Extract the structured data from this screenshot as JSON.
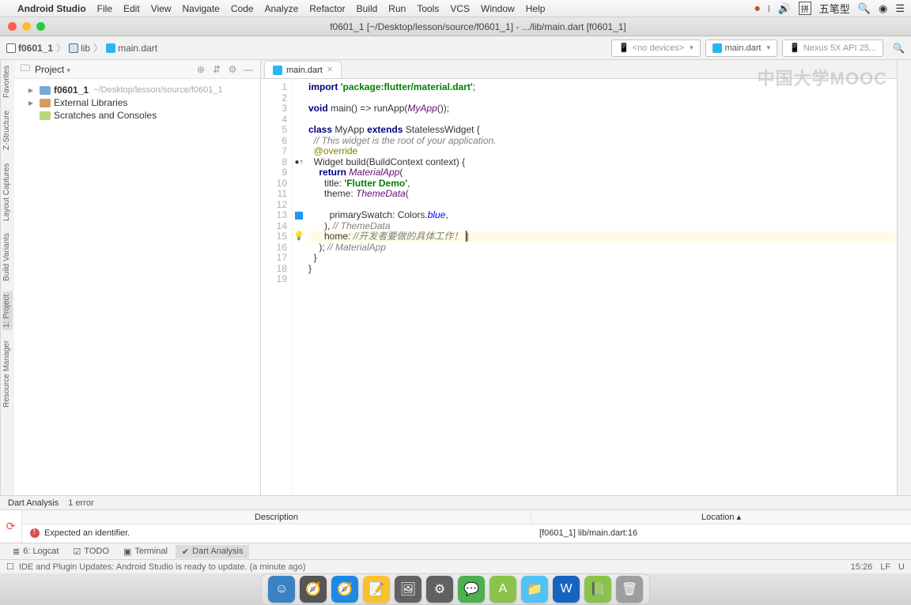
{
  "menubar": {
    "apple": "",
    "app_name": "Android Studio",
    "items": [
      "File",
      "Edit",
      "View",
      "Navigate",
      "Code",
      "Analyze",
      "Refactor",
      "Build",
      "Run",
      "Tools",
      "VCS",
      "Window",
      "Help"
    ],
    "right_icons": [
      "record-icon",
      "wifi-icon",
      "volume-icon",
      "ime-icon",
      "input-method",
      "search-icon",
      "siri-icon",
      "menu-icon"
    ],
    "input_method": "五笔型"
  },
  "window": {
    "title": "f0601_1 [~/Desktop/lesson/source/f0601_1] - .../lib/main.dart [f0601_1]"
  },
  "breadcrumb": {
    "project": "f0601_1",
    "folder": "lib",
    "file": "main.dart"
  },
  "toolbar": {
    "devices": "<no devices>",
    "run_config": "main.dart",
    "emulator": "Nexus 5X API 25..."
  },
  "watermark": "中国大学MOOC",
  "project_panel": {
    "title": "Project",
    "tree": [
      {
        "name": "f0601_1",
        "path": "~/Desktop/lesson/source/f0601_1",
        "kind": "project",
        "bold": true
      },
      {
        "name": "External Libraries",
        "kind": "lib"
      },
      {
        "name": "Scratches and Consoles",
        "kind": "scr"
      }
    ]
  },
  "side_tabs_left": [
    "Resource Manager",
    "1: Project",
    "Build Variants",
    "Layout Captures",
    "Z-Structure",
    "Favorites"
  ],
  "editor": {
    "tab": "main.dart",
    "lines": [
      {
        "n": 1,
        "segs": [
          {
            "t": "import ",
            "c": "kw"
          },
          {
            "t": "'package:flutter/material.dart'",
            "c": "str"
          },
          {
            "t": ";"
          }
        ]
      },
      {
        "n": 2,
        "segs": []
      },
      {
        "n": 3,
        "segs": [
          {
            "t": "void ",
            "c": "kw"
          },
          {
            "t": "main() => runApp("
          },
          {
            "t": "MyApp",
            "c": "cls"
          },
          {
            "t": "());"
          }
        ]
      },
      {
        "n": 4,
        "segs": []
      },
      {
        "n": 5,
        "segs": [
          {
            "t": "class ",
            "c": "kw"
          },
          {
            "t": "MyApp "
          },
          {
            "t": "extends ",
            "c": "kw"
          },
          {
            "t": "StatelessWidget {"
          }
        ]
      },
      {
        "n": 6,
        "segs": [
          {
            "t": "  "
          },
          {
            "t": "// This widget is the root of your application.",
            "c": "com"
          }
        ]
      },
      {
        "n": 7,
        "segs": [
          {
            "t": "  "
          },
          {
            "t": "@override",
            "c": "at"
          }
        ]
      },
      {
        "n": 8,
        "segs": [
          {
            "t": "  Widget build(BuildContext context) {"
          }
        ],
        "mark": "override"
      },
      {
        "n": 9,
        "segs": [
          {
            "t": "    "
          },
          {
            "t": "return ",
            "c": "kw"
          },
          {
            "t": "MaterialApp",
            "c": "cls"
          },
          {
            "t": "("
          }
        ]
      },
      {
        "n": 10,
        "segs": [
          {
            "t": "      title: "
          },
          {
            "t": "'Flutter Demo'",
            "c": "str"
          },
          {
            "t": ","
          }
        ]
      },
      {
        "n": 11,
        "segs": [
          {
            "t": "      theme: "
          },
          {
            "t": "ThemeData",
            "c": "cls"
          },
          {
            "t": "("
          }
        ]
      },
      {
        "n": 12,
        "segs": []
      },
      {
        "n": 13,
        "segs": [
          {
            "t": "        primarySwatch: Colors."
          },
          {
            "t": "blue",
            "c": "blue"
          },
          {
            "t": ","
          }
        ],
        "mark": "blue"
      },
      {
        "n": 14,
        "segs": [
          {
            "t": "      ), "
          },
          {
            "t": "// ThemeData",
            "c": "com"
          }
        ]
      },
      {
        "n": 15,
        "segs": [
          {
            "t": "      home: "
          },
          {
            "t": "//开发者要做的具体工作！ ",
            "c": "com"
          },
          {
            "t": "|",
            "c": "caret"
          }
        ],
        "mark": "bulb",
        "hl": true
      },
      {
        "n": 16,
        "segs": [
          {
            "t": "    ); "
          },
          {
            "t": "// MaterialApp",
            "c": "com"
          }
        ]
      },
      {
        "n": 17,
        "segs": [
          {
            "t": "  }"
          }
        ]
      },
      {
        "n": 18,
        "segs": [
          {
            "t": "}"
          }
        ]
      },
      {
        "n": 19,
        "segs": []
      }
    ]
  },
  "analysis": {
    "title": "Dart Analysis",
    "error_count": "1 error",
    "columns": {
      "desc": "Description",
      "loc": "Location"
    },
    "row": {
      "desc": "Expected an identifier.",
      "loc": "[f0601_1] lib/main.dart:16"
    }
  },
  "bottom_tabs": {
    "logcat": "6: Logcat",
    "todo": "TODO",
    "terminal": "Terminal",
    "dart": "Dart Analysis"
  },
  "status": {
    "msg": "IDE and Plugin Updates: Android Studio is ready to update. (a minute ago)",
    "pos": "15:26",
    "lf": "LF",
    "enc": "U"
  },
  "dock_icons": [
    {
      "bg": "#3b82c4",
      "g": "☺"
    },
    {
      "bg": "#555",
      "g": "🧭"
    },
    {
      "bg": "#1e88e5",
      "g": "🧭"
    },
    {
      "bg": "#fbc02d",
      "g": "📝"
    },
    {
      "bg": "#616161",
      "g": "🖼"
    },
    {
      "bg": "#616161",
      "g": "⚙"
    },
    {
      "bg": "#4caf50",
      "g": "💬"
    },
    {
      "bg": "#8bc34a",
      "g": "A"
    },
    {
      "bg": "#4fc3f7",
      "g": "📁"
    },
    {
      "bg": "#1565c0",
      "g": "W"
    },
    {
      "bg": "#8bc34a",
      "g": "📗"
    },
    {
      "bg": "#9e9e9e",
      "g": "🗑"
    }
  ]
}
